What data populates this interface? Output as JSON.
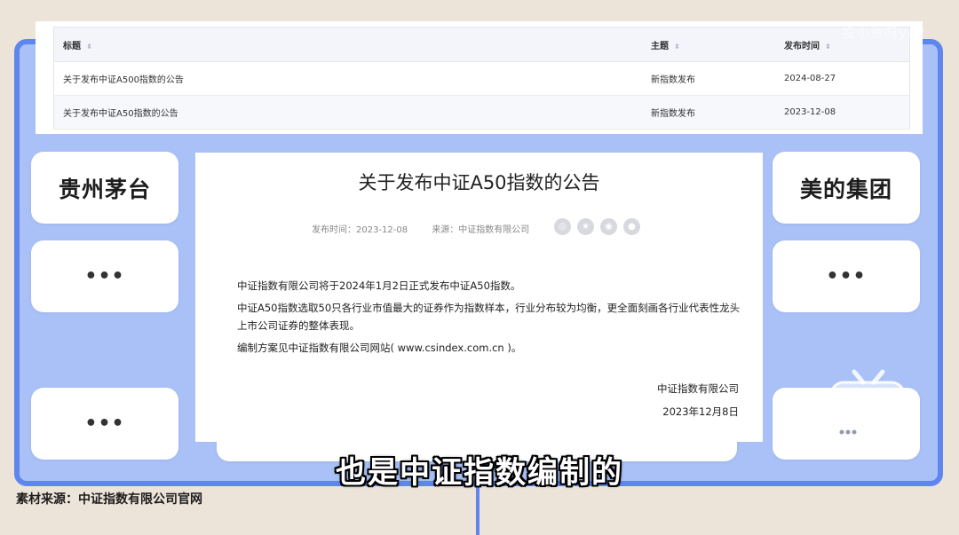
{
  "table": {
    "headers": {
      "title": "标题",
      "topic": "主题",
      "date": "发布时间"
    },
    "rows": [
      {
        "title": "关于发布中证A500指数的公告",
        "topic": "新指数发布",
        "date": "2024-08-27"
      },
      {
        "title": "关于发布中证A50指数的公告",
        "topic": "新指数发布",
        "date": "2023-12-08"
      }
    ]
  },
  "cards": {
    "left_title": "贵州茅台",
    "right_title": "美的集团",
    "ellipsis": "•••"
  },
  "document": {
    "title": "关于发布中证A50指数的公告",
    "publish_time": "发布时间：2023-12-08",
    "source": "来源：中证指数有限公司",
    "paragraphs": [
      "中证指数有限公司将于2024年1月2日正式发布中证A50指数。",
      "中证A50指数选取50只各行业市值最大的证券作为指数样本，行业分布较为均衡，更全面刻画各行业代表性龙头上市公司证券的整体表现。",
      "编制方案见中证指数有限公司网站( www.csindex.com.cn )。"
    ],
    "signature": "中证指数有限公司",
    "sign_date": "2023年12月8日",
    "share_icons": [
      "wechat-icon",
      "star-icon",
      "weibo-icon",
      "qq-icon"
    ]
  },
  "subtitle": "也是中证指数编制的",
  "source_note": "素材来源：中证指数有限公司官网",
  "watermark": "投小资呀yav",
  "colors": {
    "frame": "#5f86ee",
    "frame_fill": "#a9c1f6",
    "background": "#ece4d9"
  }
}
